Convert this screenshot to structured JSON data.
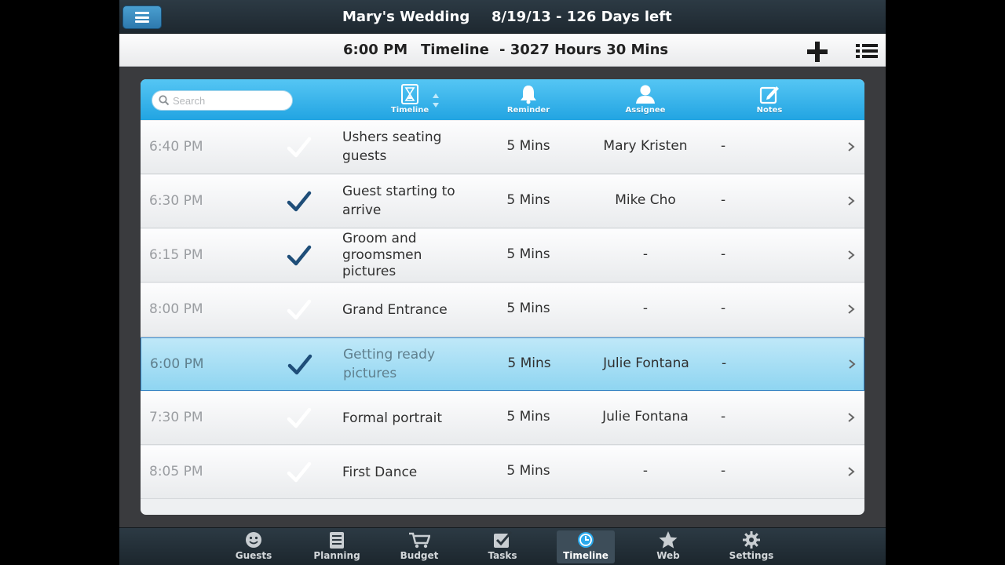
{
  "header": {
    "menu_icon": "hamburger-menu-icon",
    "title": "Mary's Wedding",
    "date": "8/19/13 - 126 Days left"
  },
  "subheader": {
    "time": "6:00 PM",
    "view": "Timeline",
    "countdown": "- 3027 Hours 30 Mins",
    "add_icon": "plus-icon",
    "list_icon": "list-view-icon"
  },
  "search": {
    "placeholder": "Search",
    "value": ""
  },
  "columns": [
    {
      "label": "Timeline",
      "icon": "hourglass-icon"
    },
    {
      "label": "Reminder",
      "icon": "bell-icon"
    },
    {
      "label": "Assignee",
      "icon": "person-icon"
    },
    {
      "label": "Notes",
      "icon": "edit-note-icon"
    }
  ],
  "rows": [
    {
      "time": "6:40 PM",
      "checked": false,
      "task": "Ushers seating guests",
      "reminder": "5 Mins",
      "assignee": "Mary Kristen",
      "notes": "-"
    },
    {
      "time": "6:30 PM",
      "checked": true,
      "task": "Guest starting to arrive",
      "reminder": "5 Mins",
      "assignee": "Mike Cho",
      "notes": "-"
    },
    {
      "time": "6:15 PM",
      "checked": true,
      "task": "Groom and groomsmen pictures",
      "reminder": "5 Mins",
      "assignee": "-",
      "notes": "-"
    },
    {
      "time": "8:00 PM",
      "checked": false,
      "task": "Grand Entrance",
      "reminder": "5 Mins",
      "assignee": "-",
      "notes": "-"
    },
    {
      "time": "6:00 PM",
      "checked": true,
      "task": "Getting ready pictures",
      "reminder": "5 Mins",
      "assignee": "Julie Fontana",
      "notes": "-",
      "selected": true
    },
    {
      "time": "7:30 PM",
      "checked": false,
      "task": "Formal portrait",
      "reminder": "5 Mins",
      "assignee": "Julie Fontana",
      "notes": "-"
    },
    {
      "time": "8:05 PM",
      "checked": false,
      "task": "First Dance",
      "reminder": "5 Mins",
      "assignee": "-",
      "notes": "-"
    }
  ],
  "tabs": [
    {
      "label": "Guests",
      "icon": "smiley-icon"
    },
    {
      "label": "Planning",
      "icon": "clipboard-icon"
    },
    {
      "label": "Budget",
      "icon": "cart-icon"
    },
    {
      "label": "Tasks",
      "icon": "checkbox-icon"
    },
    {
      "label": "Timeline",
      "icon": "clock-icon",
      "active": true
    },
    {
      "label": "Web",
      "icon": "star-icon"
    },
    {
      "label": "Settings",
      "icon": "gear-icon"
    }
  ],
  "colors": {
    "accent_blue": "#22a4e2",
    "check_navy": "#1f4e79",
    "selected_row": "#a8def4",
    "bar_dark": "#25323b"
  }
}
